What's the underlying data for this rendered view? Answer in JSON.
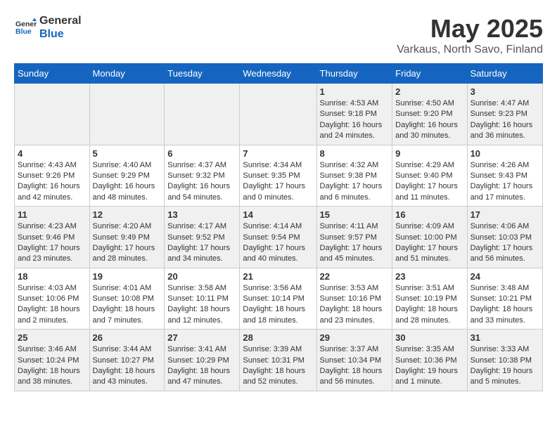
{
  "header": {
    "logo_general": "General",
    "logo_blue": "Blue",
    "title": "May 2025",
    "subtitle": "Varkaus, North Savo, Finland"
  },
  "days_of_week": [
    "Sunday",
    "Monday",
    "Tuesday",
    "Wednesday",
    "Thursday",
    "Friday",
    "Saturday"
  ],
  "weeks": [
    {
      "days": [
        {
          "number": "",
          "info": ""
        },
        {
          "number": "",
          "info": ""
        },
        {
          "number": "",
          "info": ""
        },
        {
          "number": "",
          "info": ""
        },
        {
          "number": "1",
          "info": "Sunrise: 4:53 AM\nSunset: 9:18 PM\nDaylight: 16 hours and 24 minutes."
        },
        {
          "number": "2",
          "info": "Sunrise: 4:50 AM\nSunset: 9:20 PM\nDaylight: 16 hours and 30 minutes."
        },
        {
          "number": "3",
          "info": "Sunrise: 4:47 AM\nSunset: 9:23 PM\nDaylight: 16 hours and 36 minutes."
        }
      ]
    },
    {
      "days": [
        {
          "number": "4",
          "info": "Sunrise: 4:43 AM\nSunset: 9:26 PM\nDaylight: 16 hours and 42 minutes."
        },
        {
          "number": "5",
          "info": "Sunrise: 4:40 AM\nSunset: 9:29 PM\nDaylight: 16 hours and 48 minutes."
        },
        {
          "number": "6",
          "info": "Sunrise: 4:37 AM\nSunset: 9:32 PM\nDaylight: 16 hours and 54 minutes."
        },
        {
          "number": "7",
          "info": "Sunrise: 4:34 AM\nSunset: 9:35 PM\nDaylight: 17 hours and 0 minutes."
        },
        {
          "number": "8",
          "info": "Sunrise: 4:32 AM\nSunset: 9:38 PM\nDaylight: 17 hours and 6 minutes."
        },
        {
          "number": "9",
          "info": "Sunrise: 4:29 AM\nSunset: 9:40 PM\nDaylight: 17 hours and 11 minutes."
        },
        {
          "number": "10",
          "info": "Sunrise: 4:26 AM\nSunset: 9:43 PM\nDaylight: 17 hours and 17 minutes."
        }
      ]
    },
    {
      "days": [
        {
          "number": "11",
          "info": "Sunrise: 4:23 AM\nSunset: 9:46 PM\nDaylight: 17 hours and 23 minutes."
        },
        {
          "number": "12",
          "info": "Sunrise: 4:20 AM\nSunset: 9:49 PM\nDaylight: 17 hours and 28 minutes."
        },
        {
          "number": "13",
          "info": "Sunrise: 4:17 AM\nSunset: 9:52 PM\nDaylight: 17 hours and 34 minutes."
        },
        {
          "number": "14",
          "info": "Sunrise: 4:14 AM\nSunset: 9:54 PM\nDaylight: 17 hours and 40 minutes."
        },
        {
          "number": "15",
          "info": "Sunrise: 4:11 AM\nSunset: 9:57 PM\nDaylight: 17 hours and 45 minutes."
        },
        {
          "number": "16",
          "info": "Sunrise: 4:09 AM\nSunset: 10:00 PM\nDaylight: 17 hours and 51 minutes."
        },
        {
          "number": "17",
          "info": "Sunrise: 4:06 AM\nSunset: 10:03 PM\nDaylight: 17 hours and 56 minutes."
        }
      ]
    },
    {
      "days": [
        {
          "number": "18",
          "info": "Sunrise: 4:03 AM\nSunset: 10:06 PM\nDaylight: 18 hours and 2 minutes."
        },
        {
          "number": "19",
          "info": "Sunrise: 4:01 AM\nSunset: 10:08 PM\nDaylight: 18 hours and 7 minutes."
        },
        {
          "number": "20",
          "info": "Sunrise: 3:58 AM\nSunset: 10:11 PM\nDaylight: 18 hours and 12 minutes."
        },
        {
          "number": "21",
          "info": "Sunrise: 3:56 AM\nSunset: 10:14 PM\nDaylight: 18 hours and 18 minutes."
        },
        {
          "number": "22",
          "info": "Sunrise: 3:53 AM\nSunset: 10:16 PM\nDaylight: 18 hours and 23 minutes."
        },
        {
          "number": "23",
          "info": "Sunrise: 3:51 AM\nSunset: 10:19 PM\nDaylight: 18 hours and 28 minutes."
        },
        {
          "number": "24",
          "info": "Sunrise: 3:48 AM\nSunset: 10:21 PM\nDaylight: 18 hours and 33 minutes."
        }
      ]
    },
    {
      "days": [
        {
          "number": "25",
          "info": "Sunrise: 3:46 AM\nSunset: 10:24 PM\nDaylight: 18 hours and 38 minutes."
        },
        {
          "number": "26",
          "info": "Sunrise: 3:44 AM\nSunset: 10:27 PM\nDaylight: 18 hours and 43 minutes."
        },
        {
          "number": "27",
          "info": "Sunrise: 3:41 AM\nSunset: 10:29 PM\nDaylight: 18 hours and 47 minutes."
        },
        {
          "number": "28",
          "info": "Sunrise: 3:39 AM\nSunset: 10:31 PM\nDaylight: 18 hours and 52 minutes."
        },
        {
          "number": "29",
          "info": "Sunrise: 3:37 AM\nSunset: 10:34 PM\nDaylight: 18 hours and 56 minutes."
        },
        {
          "number": "30",
          "info": "Sunrise: 3:35 AM\nSunset: 10:36 PM\nDaylight: 19 hours and 1 minute."
        },
        {
          "number": "31",
          "info": "Sunrise: 3:33 AM\nSunset: 10:38 PM\nDaylight: 19 hours and 5 minutes."
        }
      ]
    }
  ]
}
